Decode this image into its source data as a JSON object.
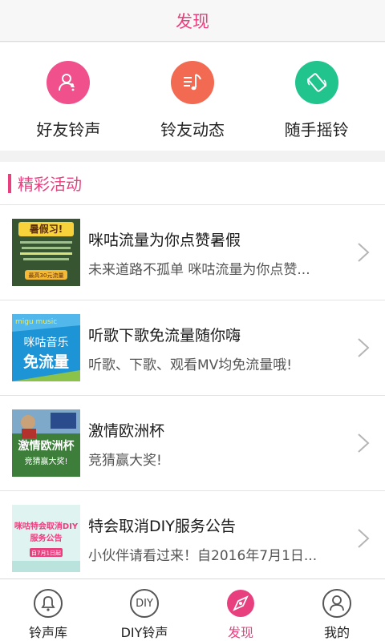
{
  "header": {
    "title": "发现"
  },
  "quick_actions": [
    {
      "label": "好友铃声",
      "icon": "friend-bell-icon",
      "color": "#f0508c"
    },
    {
      "label": "铃友动态",
      "icon": "music-list-icon",
      "color": "#f26a52"
    },
    {
      "label": "随手摇铃",
      "icon": "shake-phone-icon",
      "color": "#22c48e"
    }
  ],
  "section": {
    "title": "精彩活动"
  },
  "activities": [
    {
      "title": "咪咕流量为你点赞暑假",
      "subtitle": "未来道路不孤单 咪咕流量为你点赞..."
    },
    {
      "title": "听歌下歌免流量随你嗨",
      "subtitle": "听歌、下歌、观看MV均免流量哦!"
    },
    {
      "title": "激情欧洲杯",
      "subtitle": "竞猜赢大奖!"
    },
    {
      "title": "特会取消DIY服务公告",
      "subtitle": "小伙伴请看过来！自2016年7月1日..."
    }
  ],
  "thumbs": {
    "t1_badge": "暑假习!",
    "t1_btn": "最高30元流量",
    "t2_brand": "migu music",
    "t2_line1": "咪咕音乐",
    "t2_line2": "免流量",
    "t3_line1": "激情欧洲杯",
    "t3_line2": "竞猜赢大奖!",
    "t4_line1": "咪咕特会取消DIY",
    "t4_line2": "服务公告",
    "t4_date": "自7月1日起"
  },
  "tabs": [
    {
      "label": "铃声库",
      "icon": "bell-icon"
    },
    {
      "label": "DIY铃声",
      "icon": "diy-icon",
      "icon_text": "DIY"
    },
    {
      "label": "发现",
      "icon": "discover-icon",
      "active": true
    },
    {
      "label": "我的",
      "icon": "profile-icon"
    }
  ],
  "colors": {
    "accent": "#e8407e"
  }
}
